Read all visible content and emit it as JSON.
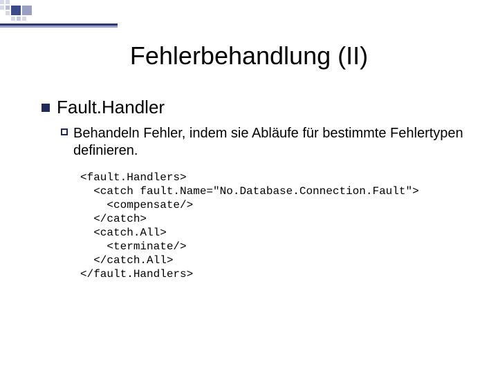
{
  "title": "Fehlerbehandlung (II)",
  "section": {
    "heading": "Fault.Handler",
    "description": "Behandeln Fehler, indem sie Abläufe für bestimmte Fehlertypen definieren.",
    "code": "<fault.Handlers>\n  <catch fault.Name=\"No.Database.Connection.Fault\">\n    <compensate/>\n  </catch>\n  <catch.All>\n    <terminate/>\n  </catch.All>\n</fault.Handlers>"
  }
}
